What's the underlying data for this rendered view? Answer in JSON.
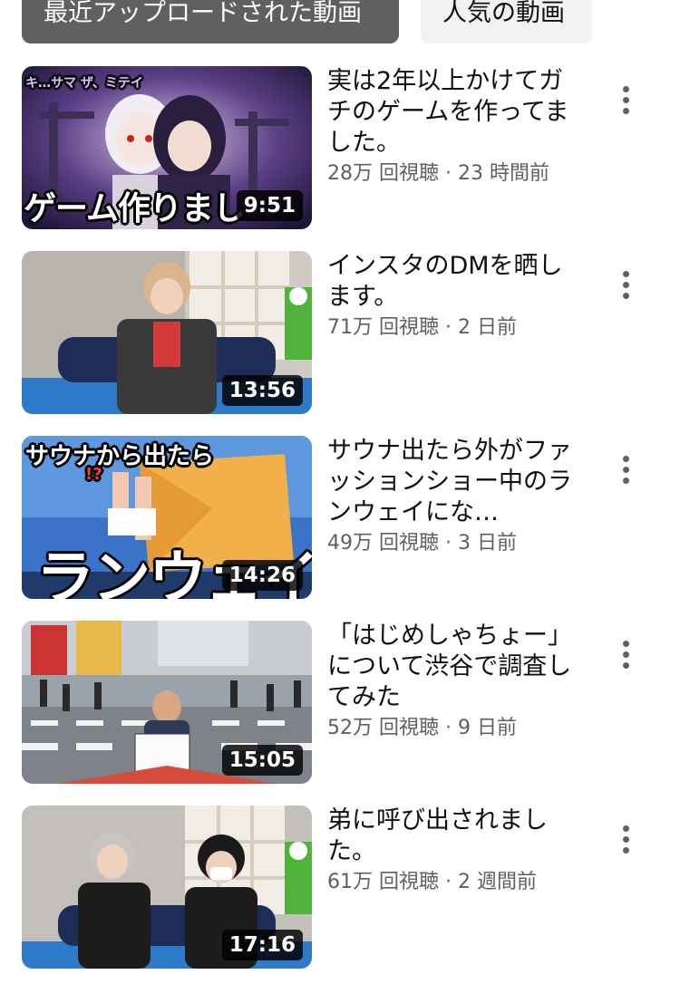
{
  "chips": {
    "recent_label": "最近アップロードされた動画",
    "popular_label": "人気の動画"
  },
  "videos": [
    {
      "title": "実は2年以上かけてガチのゲームを作ってました。",
      "meta": "28万 回視聴 · 23 時間前",
      "duration": "9:51",
      "thumb_text": "ゲーム作りまし",
      "thumb_top_text": "キ…サマ ザ、ミテイ"
    },
    {
      "title": "インスタのDMを晒します。",
      "meta": "71万 回視聴 · 2 日前",
      "duration": "13:56"
    },
    {
      "title": "サウナ出たら外がファッションショー中のランウェイにな…",
      "meta": "49万 回視聴 · 3 日前",
      "duration": "14:26",
      "thumb_text_top": "サウナから出たら",
      "thumb_text_bottom": "ランウェイ",
      "thumb_small": "!?"
    },
    {
      "title": "「はじめしゃちょー」について渋谷で調査してみた",
      "meta": "52万 回視聴 · 9 日前",
      "duration": "15:05"
    },
    {
      "title": "弟に呼び出されました。",
      "meta": "61万 回視聴 · 2 週間前",
      "duration": "17:16"
    }
  ],
  "colors": {
    "chip_active_bg": "#606060",
    "chip_inactive_bg": "#f2f2f2",
    "meta_text": "#606060"
  },
  "icons": {
    "more": "more-vert-icon"
  }
}
